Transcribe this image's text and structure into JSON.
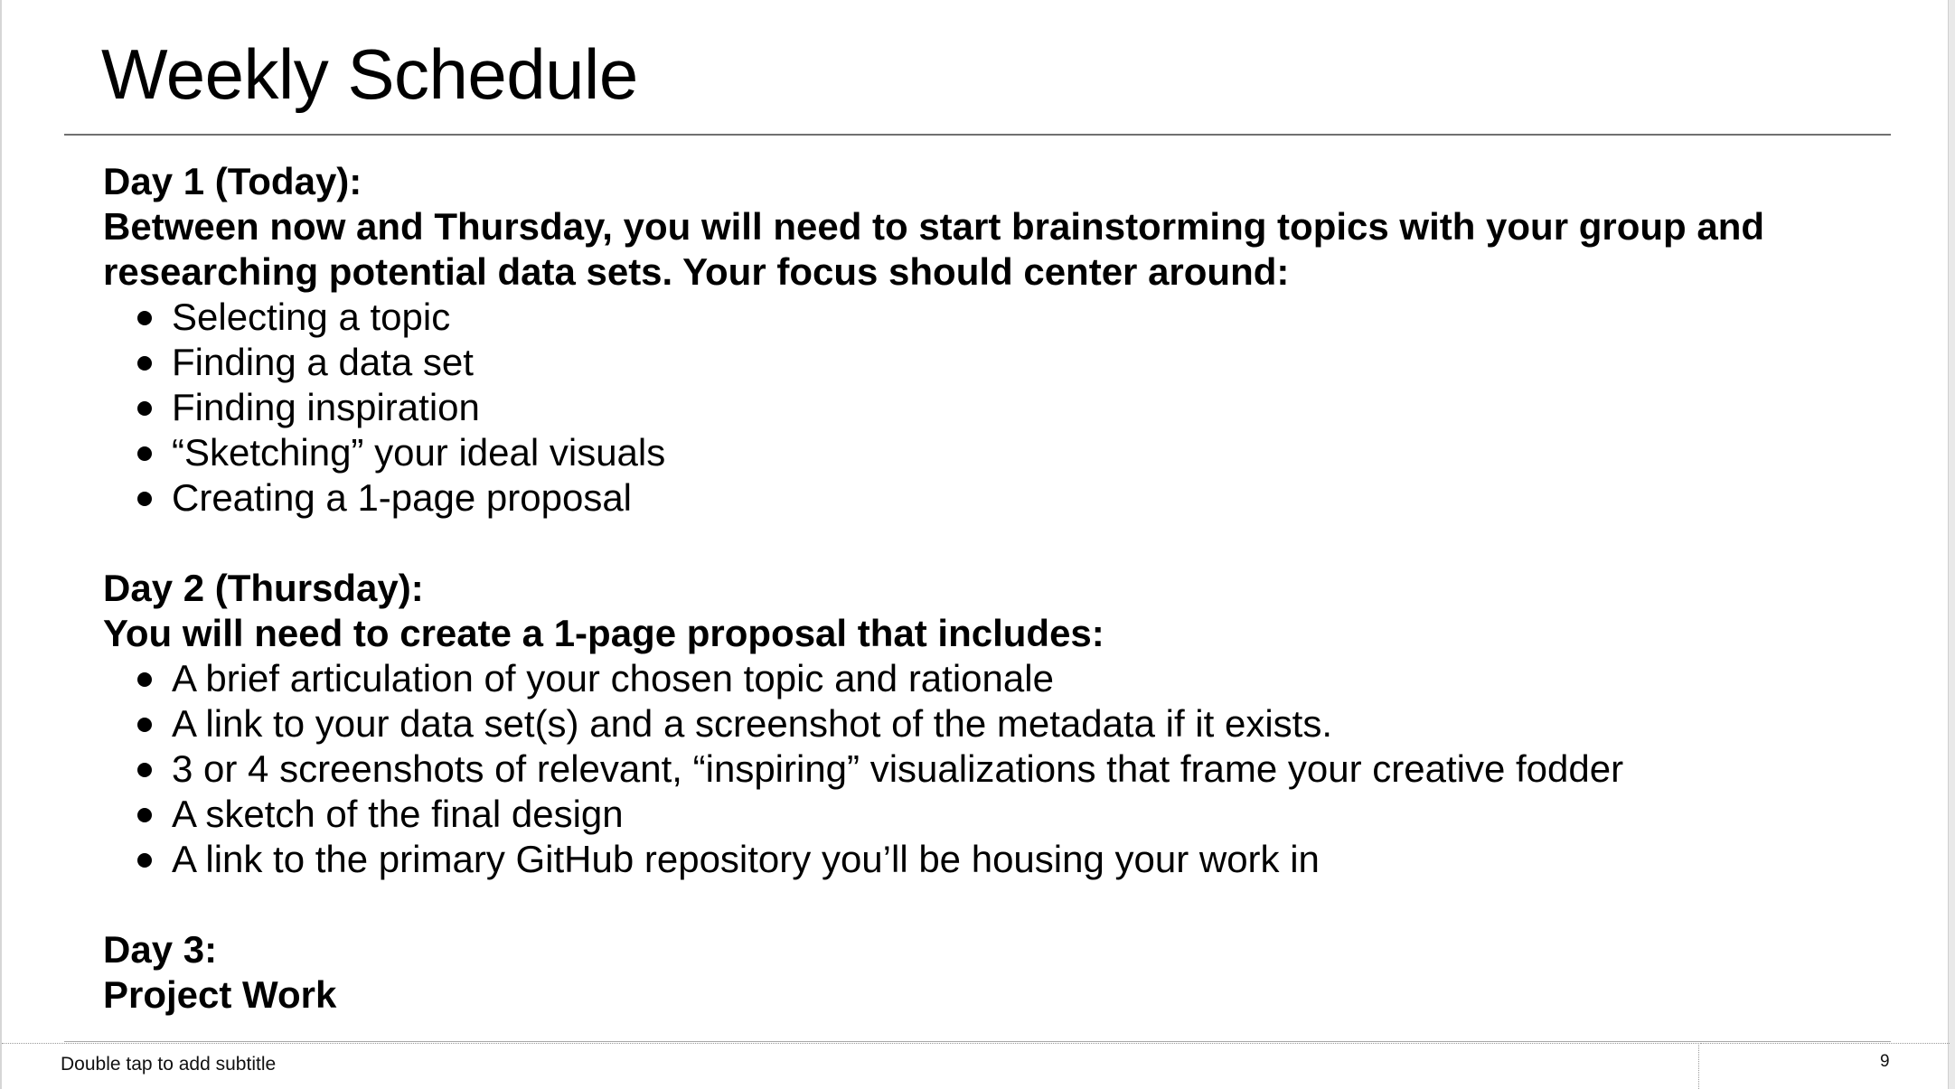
{
  "slide": {
    "title": "Weekly Schedule",
    "day1": {
      "heading": "Day 1 (Today):",
      "intro_line1": "Between now and Thursday, you will need to start brainstorming topics with your group and",
      "intro_line2": "researching potential data sets. Your focus should center around:",
      "bullets": [
        "Selecting a topic",
        "Finding a data set",
        "Finding inspiration",
        "“Sketching” your ideal visuals",
        "Creating a 1-page proposal"
      ]
    },
    "day2": {
      "heading": "Day 2 (Thursday):",
      "intro": "You will need to create a 1-page proposal that includes:",
      "bullets": [
        "A brief articulation of your chosen topic and rationale",
        "A link to your data set(s) and a screenshot of the metadata if it exists.",
        "3 or 4 screenshots of relevant, “inspiring” visualizations that frame your creative fodder",
        "A sketch of the final design",
        "A link to the primary GitHub repository you’ll be housing your work in"
      ]
    },
    "day3": {
      "heading": "Day 3:",
      "intro": "Project Work"
    }
  },
  "footer": {
    "subtitle_placeholder": "Double tap to add subtitle",
    "page_number": "9"
  }
}
